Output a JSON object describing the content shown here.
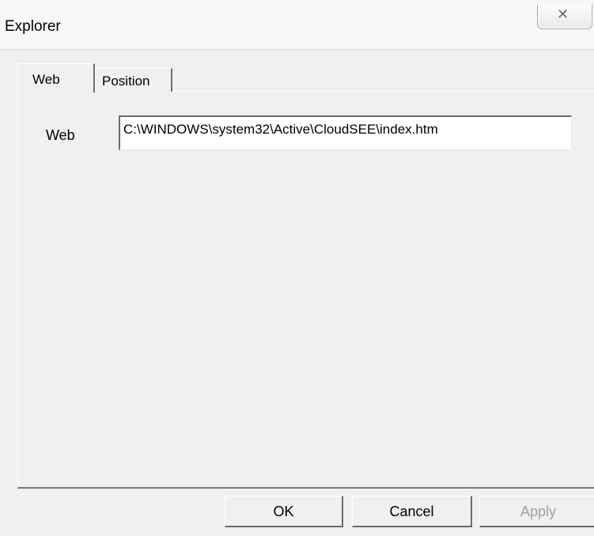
{
  "window": {
    "title": "Explorer",
    "close_glyph": "✕"
  },
  "tabs": [
    {
      "label": "Web",
      "selected": true
    },
    {
      "label": "Position",
      "selected": false
    }
  ],
  "web_field": {
    "label": "Web",
    "value": "C:\\WINDOWS\\system32\\Active\\CloudSEE\\index.htm"
  },
  "buttons": {
    "ok": "OK",
    "cancel": "Cancel",
    "apply": "Apply"
  },
  "icons": {
    "close": "close-icon"
  }
}
